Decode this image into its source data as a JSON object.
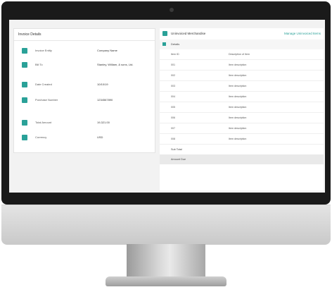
{
  "invoice": {
    "title": "Invoice Details",
    "rows": [
      {
        "icon": "building-icon",
        "label": "Invoice Entity",
        "value": "Company Name"
      },
      {
        "icon": "user-icon",
        "label": "Bill To",
        "value": "Stanley, William, & sons, Ltd."
      },
      {
        "icon": "calendar-icon",
        "label": "Date Created",
        "value": "10/10/19"
      },
      {
        "icon": "invoice-icon",
        "label": "Purchase Number",
        "value": "1234567890"
      },
      {
        "icon": "home-icon",
        "label": "Total Amount",
        "value": "19,321.00"
      },
      {
        "icon": "currency-icon",
        "label": "Currency",
        "value": "USD"
      }
    ]
  },
  "payments": {
    "title": "Uninvoiced Merchandise",
    "link": "Manage Uninvoiced Items",
    "details_label": "Details",
    "lines": [
      {
        "key": "Item ID",
        "value": "Description of Item"
      },
      {
        "key": "001",
        "value": "Item description"
      },
      {
        "key": "002",
        "value": "Item description"
      },
      {
        "key": "003",
        "value": "Item description"
      },
      {
        "key": "004",
        "value": "Item description"
      },
      {
        "key": "005",
        "value": "Item description"
      },
      {
        "key": "006",
        "value": "Item description"
      },
      {
        "key": "007",
        "value": "Item description"
      },
      {
        "key": "008",
        "value": "Item description"
      }
    ],
    "total_label": "Sub Total",
    "amount_label": "Amount Due"
  },
  "colors": {
    "accent": "#2aa198",
    "bezel": "#1a1a1a"
  }
}
